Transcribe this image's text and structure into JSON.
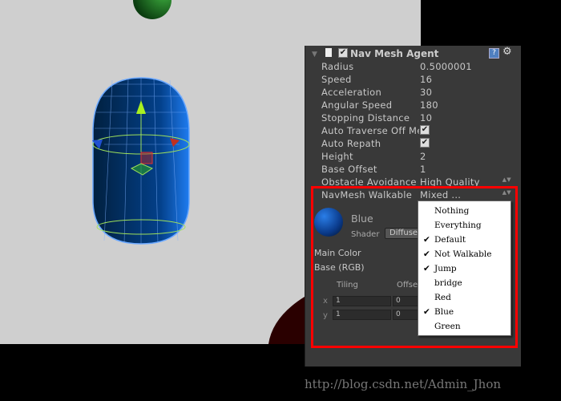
{
  "component": {
    "title": "Nav Mesh Agent",
    "enabled": true
  },
  "properties": [
    {
      "label": "Radius",
      "value": "0.5000001"
    },
    {
      "label": "Speed",
      "value": "16"
    },
    {
      "label": "Acceleration",
      "value": "30"
    },
    {
      "label": "Angular Speed",
      "value": "180"
    },
    {
      "label": "Stopping Distance",
      "value": "10"
    },
    {
      "label": "Auto Traverse Off Me",
      "checked": true
    },
    {
      "label": "Auto Repath",
      "checked": true
    },
    {
      "label": "Height",
      "value": "2"
    },
    {
      "label": "Base Offset",
      "value": "1"
    },
    {
      "label": "Obstacle Avoidance T",
      "value": "High Quality"
    },
    {
      "label": "NavMesh Walkable",
      "value": "Mixed ..."
    }
  ],
  "material": {
    "name": "Blue",
    "shader_label": "Shader",
    "shader": "Diffuse",
    "main_color": "Main Color",
    "base": "Base (RGB)",
    "tiling": "Tiling",
    "offset": "Offse",
    "x": "x",
    "y": "y",
    "tx": "1",
    "ty": "1",
    "ox": "0",
    "oy": "0"
  },
  "menu": [
    {
      "label": "Nothing",
      "checked": false
    },
    {
      "label": "Everything",
      "checked": false
    },
    {
      "label": "Default",
      "checked": true
    },
    {
      "label": "Not Walkable",
      "checked": true
    },
    {
      "label": "Jump",
      "checked": true
    },
    {
      "label": "bridge",
      "checked": false
    },
    {
      "label": "Red",
      "checked": false
    },
    {
      "label": "Blue",
      "checked": true
    },
    {
      "label": "Green",
      "checked": false
    }
  ],
  "check_glyph": "✔",
  "watermark": "http://blog.csdn.net/Admin_Jhon",
  "colors": {
    "highlight": "#ff0000",
    "panel": "#393939",
    "scene": "#cfcfcf"
  }
}
